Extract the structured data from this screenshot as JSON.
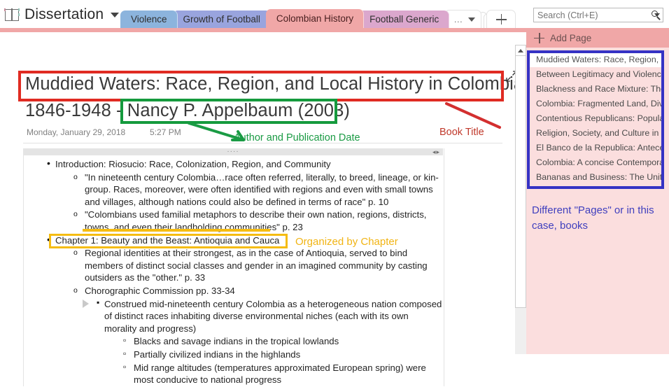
{
  "app": {
    "notebook_name": "Dissertation",
    "notebook_icon": "notebook-icon",
    "dropdown_icon": "chevron-down-icon"
  },
  "tabs": [
    {
      "label": "Violence",
      "color": "#8cb4dd",
      "active": false
    },
    {
      "label": "Growth of Football",
      "color": "#99a4de",
      "active": false
    },
    {
      "label": "Colombian History",
      "color": "#f0a7a7",
      "active": true
    },
    {
      "label": "Football Generic",
      "color": "#dba7cd",
      "active": false
    }
  ],
  "tab_controls": {
    "more_dots": "…",
    "more_icon": "chevron-down-icon",
    "add_icon": "plus-icon"
  },
  "search": {
    "placeholder": "Search (Ctrl+E)",
    "value": "",
    "icon": "search-icon",
    "dropdown_icon": "chevron-down-icon"
  },
  "page_panel": {
    "add_page_label": "Add Page",
    "add_page_icon": "plus-icon",
    "pages": [
      {
        "label": "Muddied Waters: Race, Region, a",
        "selected": true
      },
      {
        "label": "Between Legitimacy and Violence",
        "selected": false
      },
      {
        "label": "Blackness and Race Mixture: The",
        "selected": false
      },
      {
        "label": "Colombia: Fragmented Land, Divi",
        "selected": false
      },
      {
        "label": "Contentious Republicans: Popular",
        "selected": false
      },
      {
        "label": "Religion, Society, and Culture in C",
        "selected": false
      },
      {
        "label": "El Banco de la Republica: Antecen",
        "selected": false
      },
      {
        "label": "Colombia: A concise Contempora",
        "selected": false
      },
      {
        "label": "Bananas and Business: The United",
        "selected": false
      }
    ]
  },
  "note": {
    "title_line1": "Muddied Waters: Race, Region, and Local History in Colombia,",
    "title_line2": "1846-1948 - Nancy P. Appelbaum (2003)",
    "date": "Monday, January 29, 2018",
    "time": "5:27 PM",
    "expand_icon": "expand-arrows-icon",
    "handle_dots": "····",
    "handle_arrows": "◂▸"
  },
  "content": {
    "items": [
      {
        "level": 1,
        "text": "Introduction: Riosucio: Race, Colonization, Region, and Community"
      },
      {
        "level": 2,
        "text": "\"In nineteenth century Colombia…race often referred, literally, to breed, lineage, or kin-group. Races, moreover, were often identified with regions and even with small towns and villages, although nations could also be defined in terms of race\" p. 10"
      },
      {
        "level": 2,
        "text": "\"Colombians used familial metaphors to describe their own nation, regions, districts, towns, and even their landholding communities\" p. 23"
      },
      {
        "level": 1,
        "text": "Chapter 1: Beauty and the Beast: Antioquia and Cauca"
      },
      {
        "level": 2,
        "text": "Regional identities at their strongest, as in the case of Antioquia, served to bind members of distinct social classes and gender in an imagined community by casting outsiders as the \"other.\" p. 33"
      },
      {
        "level": 2,
        "text": "Chorographic Commission pp. 33-34"
      },
      {
        "level": 3,
        "text": "Construed mid-nineteenth century Colombia as a heterogeneous nation composed of distinct races inhabiting diverse environmental niches (each with its own morality and progress)"
      },
      {
        "level": 4,
        "text": "Blacks and savage indians in the tropical lowlands"
      },
      {
        "level": 4,
        "text": "Partially civilized indians in the highlands"
      },
      {
        "level": 4,
        "text": "Mid range altitudes (temperatures approximated European spring) were most conducive to national progress"
      }
    ]
  },
  "annotations": {
    "book_title": {
      "text": "Book Title",
      "color": "#c0392b"
    },
    "author_date": {
      "text": "Author and Publication Date",
      "color": "#1a9b44"
    },
    "organized_by_chapter": {
      "text": "Organized by Chapter",
      "color": "#f1b414"
    },
    "pages_note": {
      "text": "Different \"Pages\" or in this case, books",
      "color": "#3f3fbe"
    }
  },
  "scrollbar": {
    "up_icon": "caret-up-icon"
  }
}
